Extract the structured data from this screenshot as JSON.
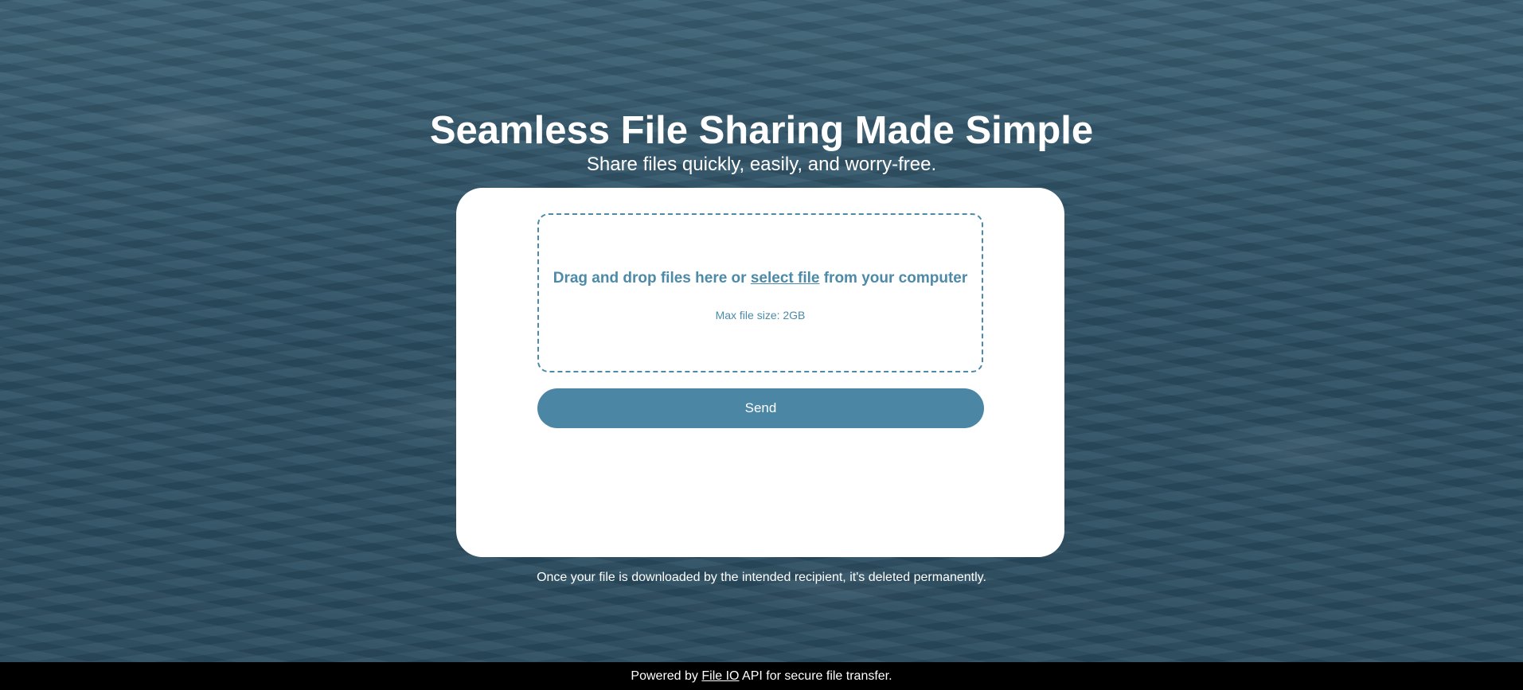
{
  "hero": {
    "title": "Seamless File Sharing Made Simple",
    "subtitle": "Share files quickly, easily, and worry-free."
  },
  "upload": {
    "drop_text_before": "Drag and drop files here or ",
    "select_link": "select file",
    "drop_text_after": " from your computer",
    "max_size": "Max file size: 2GB",
    "send_label": "Send"
  },
  "notice": "Once your file is downloaded by the intended recipient, it's deleted permanently.",
  "footer": {
    "prefix": "Powered by ",
    "link": "File IO",
    "suffix": " API for secure file transfer."
  },
  "colors": {
    "accent": "#4b87a5",
    "card": "#ffffff",
    "footer_bg": "#000000"
  }
}
